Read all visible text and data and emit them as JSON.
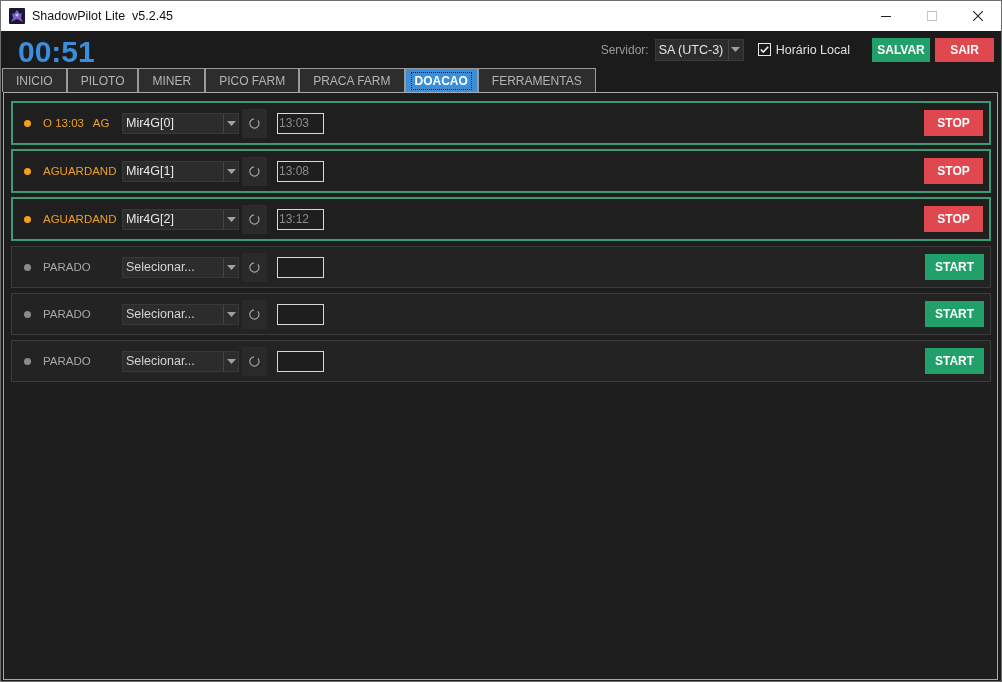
{
  "window": {
    "title": "ShadowPilot Lite  v5.2.45",
    "controls": [
      {
        "kind": "minimize",
        "disabled": false
      },
      {
        "kind": "maximize",
        "disabled": true
      },
      {
        "kind": "close",
        "disabled": false
      }
    ]
  },
  "header": {
    "timer": "00:51",
    "server": {
      "label": "Servidor:",
      "value": "SA (UTC-3)"
    },
    "local_time": {
      "label": "Horário Local",
      "checked": true
    },
    "buttons": [
      {
        "label": "SALVAR",
        "kind": "save"
      },
      {
        "label": "SAIR",
        "kind": "exit"
      }
    ]
  },
  "tabs": [
    {
      "label": "INICIO",
      "selected": false
    },
    {
      "label": "PILOTO",
      "selected": false
    },
    {
      "label": "MINER",
      "selected": false
    },
    {
      "label": "PICO FARM",
      "selected": false
    },
    {
      "label": "PRACA FARM",
      "selected": false
    },
    {
      "label": "DOACAO",
      "selected": true
    },
    {
      "label": "FERRAMENTAS",
      "selected": false
    }
  ],
  "bots": [
    {
      "running": true,
      "color": "#f0a020",
      "status": "O 13:03   AG",
      "account": {
        "value": "Mir4G[0]"
      },
      "time": "13:03",
      "action": "STOP"
    },
    {
      "running": true,
      "color": "#f0a020",
      "status": "AGUARDAND",
      "account": {
        "value": "Mir4G[1]"
      },
      "time": "13:08",
      "action": "STOP"
    },
    {
      "running": true,
      "color": "#f0a020",
      "status": "AGUARDAND",
      "account": {
        "value": "Mir4G[2]"
      },
      "time": "13:12",
      "action": "STOP"
    },
    {
      "running": false,
      "color": "#8a8a8a",
      "status": "PARADO",
      "account": {
        "placeholder": "Selecionar..."
      },
      "action": "START"
    },
    {
      "running": false,
      "color": "#8a8a8a",
      "status": "PARADO",
      "account": {
        "placeholder": "Selecionar..."
      },
      "action": "START"
    },
    {
      "running": false,
      "color": "#8a8a8a",
      "status": "PARADO",
      "account": {
        "placeholder": "Selecionar..."
      },
      "action": "START"
    }
  ]
}
